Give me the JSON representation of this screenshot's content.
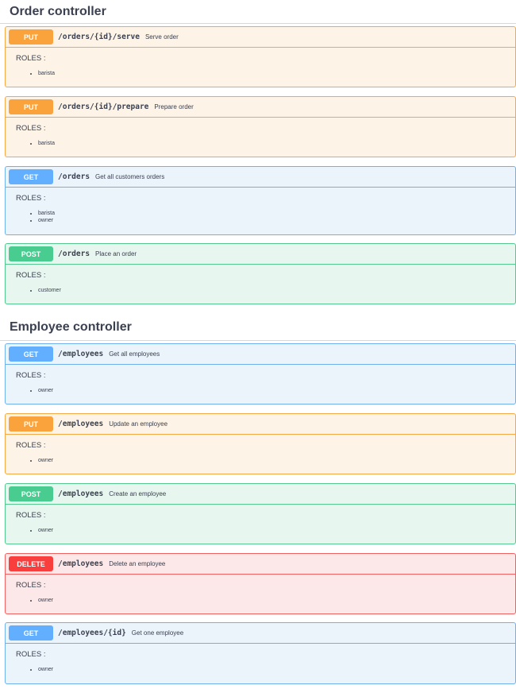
{
  "order_controller": {
    "title": "Order controller",
    "operations": [
      {
        "method": "PUT",
        "path": "/orders/{id}/serve",
        "summary": "Serve order",
        "roles_label": "ROLES :",
        "roles": [
          "barista"
        ]
      },
      {
        "method": "PUT",
        "path": "/orders/{id}/prepare",
        "summary": "Prepare order",
        "roles_label": "ROLES :",
        "roles": [
          "barista"
        ]
      },
      {
        "method": "GET",
        "path": "/orders",
        "summary": "Get all customers orders",
        "roles_label": "ROLES :",
        "roles": [
          "barista",
          "owner"
        ]
      },
      {
        "method": "POST",
        "path": "/orders",
        "summary": "Place an order",
        "roles_label": "ROLES :",
        "roles": [
          "customer"
        ]
      }
    ]
  },
  "employee_controller": {
    "title": "Employee controller",
    "operations": [
      {
        "method": "GET",
        "path": "/employees",
        "summary": "Get all employees",
        "roles_label": "ROLES :",
        "roles": [
          "owner"
        ]
      },
      {
        "method": "PUT",
        "path": "/employees",
        "summary": "Update an employee",
        "roles_label": "ROLES :",
        "roles": [
          "owner"
        ]
      },
      {
        "method": "POST",
        "path": "/employees",
        "summary": "Create an employee",
        "roles_label": "ROLES :",
        "roles": [
          "owner"
        ]
      },
      {
        "method": "DELETE",
        "path": "/employees",
        "summary": "Delete an employee",
        "roles_label": "ROLES :",
        "roles": [
          "owner"
        ]
      },
      {
        "method": "GET",
        "path": "/employees/{id}",
        "summary": "Get one employee",
        "roles_label": "ROLES :",
        "roles": [
          "owner"
        ]
      }
    ]
  },
  "colors": {
    "put": "#faa33d",
    "get": "#61affe",
    "post": "#49cc90",
    "delete": "#f93e3e",
    "text": "#3b4151"
  }
}
